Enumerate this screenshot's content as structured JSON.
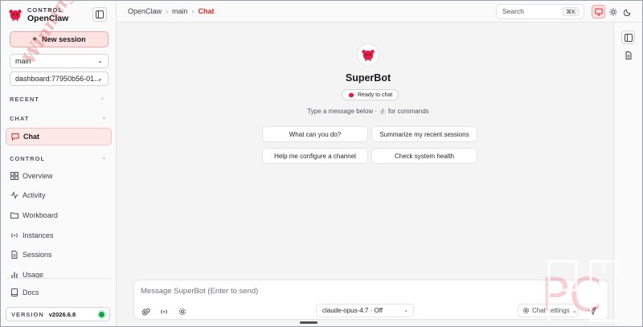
{
  "brand": {
    "kicker": "CONTROL",
    "name": "OpenClaw"
  },
  "sidebar": {
    "new_session_label": "New session",
    "agent_select": "main",
    "session_select": "dashboard:77950b56-01...",
    "sections": {
      "recent": "RECENT",
      "chat": "CHAT",
      "control": "CONTROL"
    },
    "chat_item": "Chat",
    "control_items": [
      "Overview",
      "Activity",
      "Workboard",
      "Instances",
      "Sessions",
      "Usage"
    ],
    "docs_label": "Docs",
    "version_label": "VERSION",
    "version_value": "v2026.6.8"
  },
  "topbar": {
    "breadcrumb": [
      "OpenClaw",
      "main",
      "Chat"
    ],
    "search_placeholder": "Search",
    "search_shortcut": "⌘K"
  },
  "main": {
    "bot_name": "SuperBot",
    "status": "Ready to chat",
    "hint_prefix": "Type a message below ·",
    "hint_key": "/",
    "hint_suffix": "for commands",
    "suggestions": [
      "What can you do?",
      "Summarize my recent sessions",
      "Help me configure a channel",
      "Check system health"
    ]
  },
  "composer": {
    "placeholder": "Message SuperBot (Enter to send)",
    "model": "claude-opus-4.7 · Off",
    "settings_label": "Chat settings"
  },
  "watermark": {
    "text": "Winning PC",
    "logo": "PC"
  },
  "colors": {
    "accent": "#dc2626",
    "accent_soft": "#fde2e2",
    "status_online": "#16a34a"
  }
}
